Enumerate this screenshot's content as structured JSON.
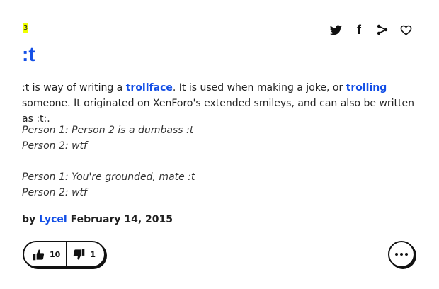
{
  "definition": {
    "rank": "3",
    "word": ":t",
    "meaning": {
      "part1": ":t is way of writing a ",
      "link1": "trollface",
      "part2": ". It is used when making a joke, or ",
      "link2": "trolling",
      "part3": " someone. It originated on XenForo's extended smileys, and can also be written as :t:."
    },
    "example_lines": [
      "Person 1: Person 2 is a dumbass :t",
      "Person 2: wtf",
      "",
      "Person 1: You're grounded, mate :t",
      "Person 2: wtf"
    ],
    "contributor": {
      "prefix": "by ",
      "author": "Lycel",
      "date": "February 14, 2015"
    },
    "votes": {
      "up": "10",
      "down": "1"
    }
  },
  "share": {
    "icons": [
      "twitter-icon",
      "facebook-icon",
      "share-icon",
      "heart-icon"
    ],
    "facebook_glyph": "f"
  },
  "colors": {
    "link": "#134fe6",
    "rank_highlight": "#efff00",
    "border": "#111111"
  }
}
